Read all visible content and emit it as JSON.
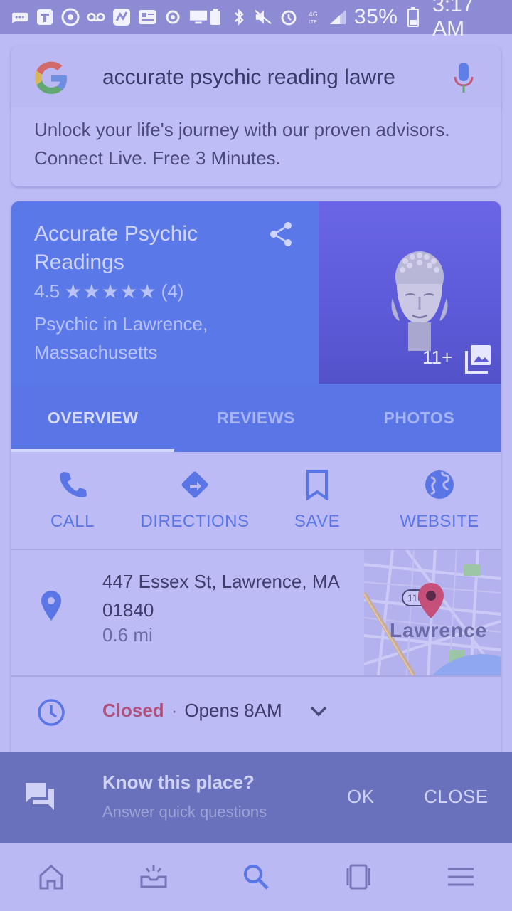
{
  "status_bar": {
    "battery_percent": "35%",
    "time": "3:17 AM",
    "icons": [
      "messages-icon",
      "t-app-icon",
      "eye-icon",
      "voicemail-icon",
      "nfc-icon",
      "news-icon",
      "circle-icon",
      "monitor-icon",
      "battery-saver-icon",
      "bluetooth-icon",
      "mute-icon",
      "alarm-icon",
      "lte-icon",
      "signal-icon",
      "battery-icon"
    ]
  },
  "search": {
    "query": "accurate psychic reading lawre",
    "logo": "google-logo",
    "mic_icon": "mic-icon"
  },
  "ad": {
    "text": "Unlock your life's journey with our proven advisors. Connect Live. Free 3 Minutes."
  },
  "place": {
    "name": "Accurate Psychic Readings",
    "rating": "4.5",
    "stars": "★★★★★",
    "review_count": "(4)",
    "type": "Psychic in Lawrence, Massachusetts",
    "photo_count": "11+"
  },
  "tabs": [
    {
      "label": "OVERVIEW",
      "active": true
    },
    {
      "label": "REVIEWS",
      "active": false
    },
    {
      "label": "PHOTOS",
      "active": false
    }
  ],
  "actions": [
    {
      "label": "CALL",
      "icon": "phone-icon"
    },
    {
      "label": "DIRECTIONS",
      "icon": "directions-icon"
    },
    {
      "label": "SAVE",
      "icon": "bookmark-icon"
    },
    {
      "label": "WEBSITE",
      "icon": "globe-icon"
    }
  ],
  "address": {
    "line": "447 Essex St, Lawrence, MA 01840",
    "distance": "0.6 mi"
  },
  "map": {
    "label": "Lawrence",
    "route": "110"
  },
  "hours": {
    "status": "Closed",
    "separator": "·",
    "opens": "Opens 8AM"
  },
  "know_place": {
    "title": "Know this place?",
    "subtitle": "Answer quick questions",
    "ok": "OK",
    "close": "CLOSE"
  },
  "bottom_nav": [
    "home-icon",
    "updates-icon",
    "search-icon",
    "tabs-icon",
    "menu-icon"
  ],
  "colors": {
    "accent_blue": "#5a76e6",
    "closed_red": "#b0527e",
    "background": "#bdbbf5"
  }
}
